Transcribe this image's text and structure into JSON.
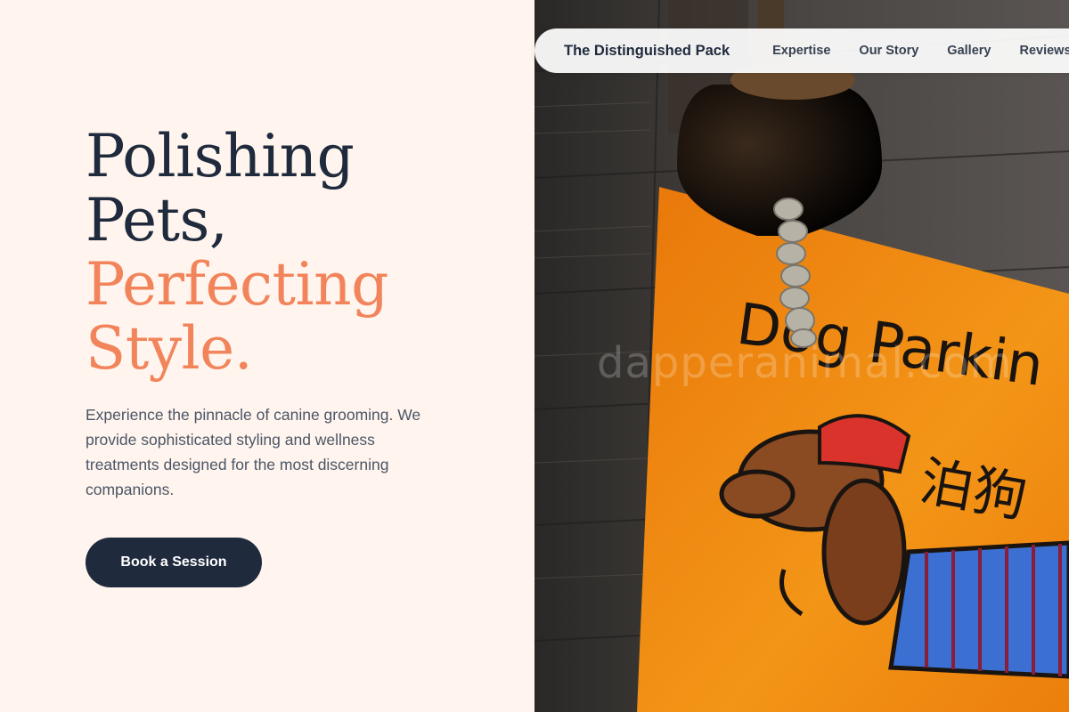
{
  "nav": {
    "brand": "The Distinguished Pack",
    "items": [
      {
        "label": "Expertise"
      },
      {
        "label": "Our Story"
      },
      {
        "label": "Gallery"
      },
      {
        "label": "Reviews"
      }
    ]
  },
  "hero": {
    "headline_line1": "Polishing",
    "headline_line2": "Pets,",
    "headline_line3": "Perfecting",
    "headline_line4": "Style.",
    "description": "Experience the pinnacle of canine grooming. We provide sophisticated styling and wellness treatments designed for the most discerning companions.",
    "cta_label": "Book a Session"
  },
  "image": {
    "sign_text": "Dog Parkin",
    "sign_cjk": "泊狗",
    "watermark": "dapperanimal.com"
  },
  "colors": {
    "background": "#fff5ee",
    "heading_dark": "#1f2a3d",
    "accent": "#f2845b",
    "body_text": "#4b5566",
    "button": "#1f2a3d",
    "sign_orange": "#f08a12"
  }
}
